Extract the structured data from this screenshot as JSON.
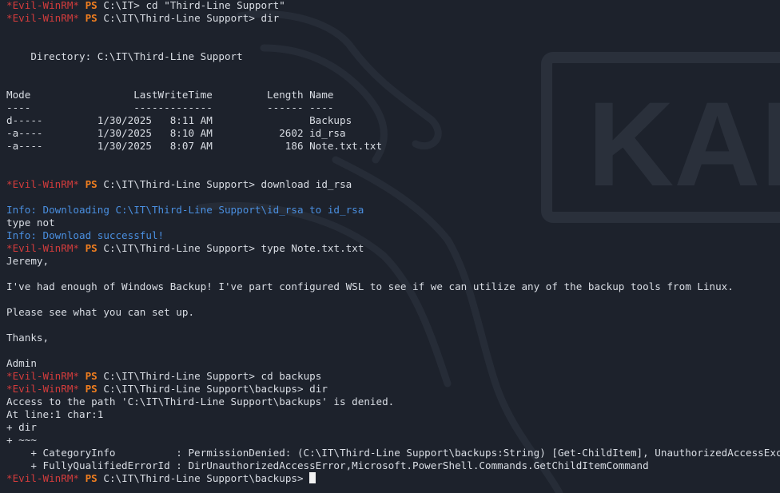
{
  "prompt": {
    "tag": "*Evil-WinRM*",
    "ps": "PS"
  },
  "lines": [
    {
      "type": "prompt",
      "path": "C:\\IT>",
      "cmd": " cd \"Third-Line Support\""
    },
    {
      "type": "prompt",
      "path": "C:\\IT\\Third-Line Support>",
      "cmd": " dir"
    },
    {
      "type": "text",
      "text": ""
    },
    {
      "type": "text",
      "text": ""
    },
    {
      "type": "text",
      "text": "    Directory: C:\\IT\\Third-Line Support"
    },
    {
      "type": "text",
      "text": ""
    },
    {
      "type": "text",
      "text": ""
    },
    {
      "type": "text",
      "text": "Mode                 LastWriteTime         Length Name"
    },
    {
      "type": "text",
      "text": "----                 -------------         ------ ----"
    },
    {
      "type": "text",
      "text": "d-----         1/30/2025   8:11 AM                Backups"
    },
    {
      "type": "text",
      "text": "-a----         1/30/2025   8:10 AM           2602 id_rsa"
    },
    {
      "type": "text",
      "text": "-a----         1/30/2025   8:07 AM            186 Note.txt.txt"
    },
    {
      "type": "text",
      "text": ""
    },
    {
      "type": "text",
      "text": ""
    },
    {
      "type": "prompt",
      "path": "C:\\IT\\Third-Line Support>",
      "cmd": " download id_rsa"
    },
    {
      "type": "text",
      "text": ""
    },
    {
      "type": "info",
      "text": "Info: Downloading C:\\IT\\Third-Line Support\\id_rsa to id_rsa"
    },
    {
      "type": "text",
      "text": "type not"
    },
    {
      "type": "info",
      "text": "Info: Download successful!"
    },
    {
      "type": "prompt",
      "path": "C:\\IT\\Third-Line Support>",
      "cmd": " type Note.txt.txt"
    },
    {
      "type": "text",
      "text": "Jeremy,"
    },
    {
      "type": "text",
      "text": ""
    },
    {
      "type": "text",
      "text": "I've had enough of Windows Backup! I've part configured WSL to see if we can utilize any of the backup tools from Linux."
    },
    {
      "type": "text",
      "text": ""
    },
    {
      "type": "text",
      "text": "Please see what you can set up."
    },
    {
      "type": "text",
      "text": ""
    },
    {
      "type": "text",
      "text": "Thanks,"
    },
    {
      "type": "text",
      "text": ""
    },
    {
      "type": "text",
      "text": "Admin"
    },
    {
      "type": "prompt",
      "path": "C:\\IT\\Third-Line Support>",
      "cmd": " cd backups"
    },
    {
      "type": "prompt",
      "path": "C:\\IT\\Third-Line Support\\backups>",
      "cmd": " dir"
    },
    {
      "type": "text",
      "text": "Access to the path 'C:\\IT\\Third-Line Support\\backups' is denied."
    },
    {
      "type": "text",
      "text": "At line:1 char:1"
    },
    {
      "type": "text",
      "text": "+ dir"
    },
    {
      "type": "text",
      "text": "+ ~~~"
    },
    {
      "type": "text",
      "text": "    + CategoryInfo          : PermissionDenied: (C:\\IT\\Third-Line Support\\backups:String) [Get-ChildItem], UnauthorizedAccessException"
    },
    {
      "type": "text",
      "text": "    + FullyQualifiedErrorId : DirUnauthorizedAccessError,Microsoft.PowerShell.Commands.GetChildItemCommand"
    },
    {
      "type": "prompt",
      "path": "C:\\IT\\Third-Line Support\\backups>",
      "cmd": " ",
      "cursor": true
    }
  ],
  "background": {
    "logo_text": "KALI",
    "colors": {
      "bg": "#1d222c",
      "logo": "#2a303b",
      "evil_tag": "#d33c3c",
      "ps_prompt": "#f07e1f",
      "info": "#4a8fe0",
      "text": "#d9dde4"
    }
  }
}
